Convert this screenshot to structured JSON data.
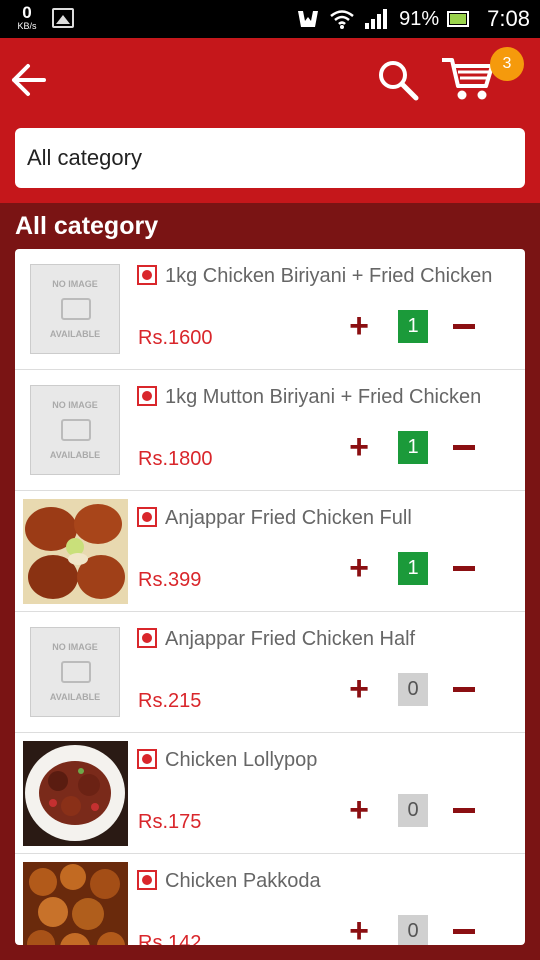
{
  "status_bar": {
    "net_speed": "0",
    "net_unit": "KB/s",
    "battery_pct": "91%",
    "time": "7:08"
  },
  "header": {
    "cart_count": "3",
    "category_value": "All category"
  },
  "section_title": "All category",
  "items": [
    {
      "name": "1kg Chicken Biriyani + Fried Chicken",
      "price": "Rs.1600",
      "qty": "1"
    },
    {
      "name": "1kg Mutton Biriyani + Fried Chicken",
      "price": "Rs.1800",
      "qty": "1"
    },
    {
      "name": "Anjappar Fried Chicken Full",
      "price": "Rs.399",
      "qty": "1"
    },
    {
      "name": "Anjappar Fried Chicken Half",
      "price": "Rs.215",
      "qty": "0"
    },
    {
      "name": "Chicken Lollypop",
      "price": "Rs.175",
      "qty": "0"
    },
    {
      "name": "Chicken Pakkoda",
      "price": "Rs.142",
      "qty": "0"
    }
  ],
  "placeholder": {
    "top": "NO IMAGE",
    "bottom": "AVAILABLE"
  },
  "colors": {
    "brand": "#c5171b",
    "dark": "#7a1414",
    "accent": "#d9262b",
    "active_qty": "#1b9a3a",
    "badge": "#f59a0c"
  }
}
